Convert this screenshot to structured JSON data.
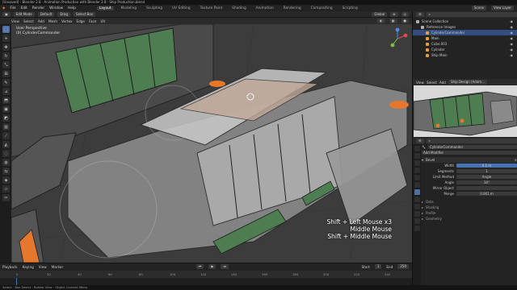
{
  "title_bar": {
    "text": "[Unsaved] - Blender 2.8 · Animation Production with Blender 2.8 · Ship Production.blend"
  },
  "menu": [
    "File",
    "Edit",
    "Render",
    "Window",
    "Help"
  ],
  "workspaces": [
    "Layout",
    "Modeling",
    "Sculpting",
    "UV Editing",
    "Texture Paint",
    "Shading",
    "Animation",
    "Rendering",
    "Compositing",
    "Scripting"
  ],
  "active_workspace": "Layout",
  "scene": {
    "label": "Scene",
    "view_layer": "View Layer"
  },
  "header": {
    "mode": "Edit Mode",
    "orientation": "Default",
    "drag": "Drag",
    "select": "Select Box",
    "pivot": "Global",
    "view_items": [
      "View",
      "Select",
      "Add",
      "Mesh",
      "Vertex",
      "Edge",
      "Face",
      "UV"
    ]
  },
  "viewport": {
    "perspective": "User Perspective",
    "object": "(0) CylinderCommander",
    "hint_lines": [
      "Shift + Left Mouse x3",
      "Middle Mouse",
      "Shift + Middle Mouse"
    ]
  },
  "timeline": {
    "menus": [
      "Playback",
      "Keying",
      "View",
      "Marker"
    ],
    "ruler": [
      "0",
      "20",
      "40",
      "60",
      "80",
      "100",
      "120",
      "140",
      "160",
      "180",
      "200",
      "220",
      "240"
    ],
    "start_label": "Start",
    "start": "1",
    "end_label": "End",
    "end": "250"
  },
  "outliner": {
    "title": "Scene Collection",
    "rows": [
      {
        "name": "Scene Collection",
        "icon": "collection-icon",
        "color": "#b0b0b0",
        "selected": false,
        "indent": 0
      },
      {
        "name": "Reference Images",
        "icon": "collection-icon",
        "color": "#b0b0b0",
        "selected": false,
        "indent": 1
      },
      {
        "name": "CylinderCommander",
        "icon": "mesh-icon",
        "color": "#e59f3a",
        "selected": true,
        "indent": 2
      },
      {
        "name": "Main",
        "icon": "mesh-icon",
        "color": "#e59f3a",
        "selected": false,
        "indent": 2
      },
      {
        "name": "Cube.003",
        "icon": "mesh-icon",
        "color": "#e59f3a",
        "selected": false,
        "indent": 2
      },
      {
        "name": "Cylinder",
        "icon": "mesh-icon",
        "color": "#e59f3a",
        "selected": false,
        "indent": 2
      },
      {
        "name": "Ship Main",
        "icon": "mesh-icon",
        "color": "#e59f3a",
        "selected": false,
        "indent": 2
      }
    ]
  },
  "mini_header": [
    "View",
    "Select",
    "Add",
    "Ship Design (Adam..."
  ],
  "properties": {
    "object_name": "CylinderCommander",
    "add_modifier": "Add Modifier",
    "modifier": "Bevel",
    "rows": [
      {
        "label": "Width",
        "value": "0.1 m"
      },
      {
        "label": "Segments",
        "value": "1"
      },
      {
        "label": "Limit Method",
        "value": "Angle"
      },
      {
        "label": "Angle",
        "value": "30°"
      },
      {
        "label": "Mirror Object",
        "value": ""
      },
      {
        "label": "Merge",
        "value": "0.001 m"
      }
    ],
    "sections": [
      "Data",
      "Shading",
      "Profile",
      "Geometry"
    ]
  },
  "status": "Select  ·  Box Select  ·  Rotate View  ·  Object Context Menu",
  "colors": {
    "accent": "#4772b3",
    "selection": "#334d80",
    "ship_green": "#4a7a4e",
    "orange": "#e5782d"
  }
}
